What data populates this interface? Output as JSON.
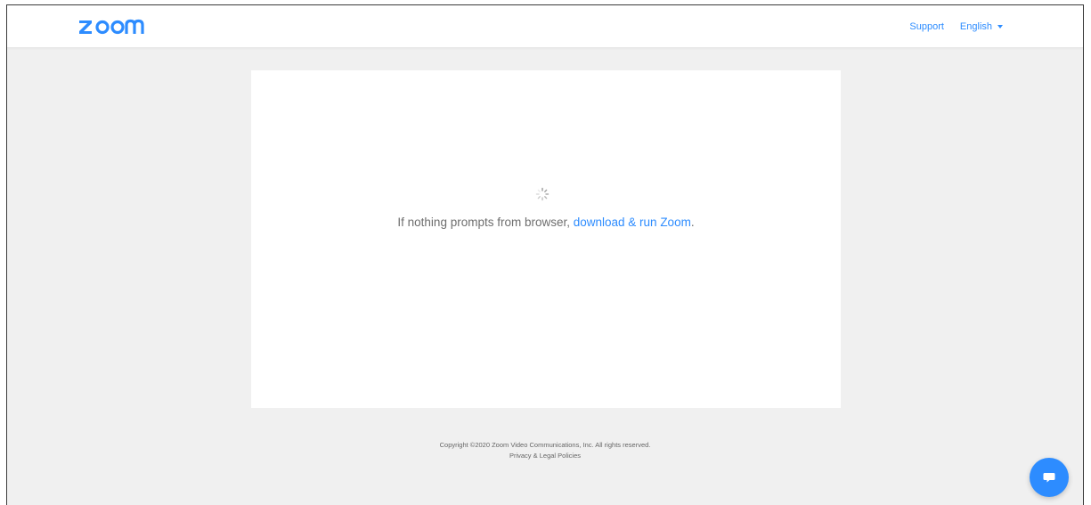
{
  "header": {
    "logo_text": "zoom",
    "support_label": "Support",
    "language_label": "English"
  },
  "main": {
    "prompt_text": "If nothing prompts from browser, ",
    "prompt_link": "download & run Zoom",
    "prompt_suffix": "."
  },
  "footer": {
    "copyright": "Copyright ©2020 Zoom Video Communications, Inc. All rights reserved.",
    "privacy_link": "Privacy & Legal Policies"
  },
  "chat": {
    "icon": "chat-bubble-icon"
  },
  "colors": {
    "brand": "#2d8cff",
    "background": "#f0f0f0",
    "card": "#ffffff",
    "text_muted": "#6e6e6e"
  }
}
